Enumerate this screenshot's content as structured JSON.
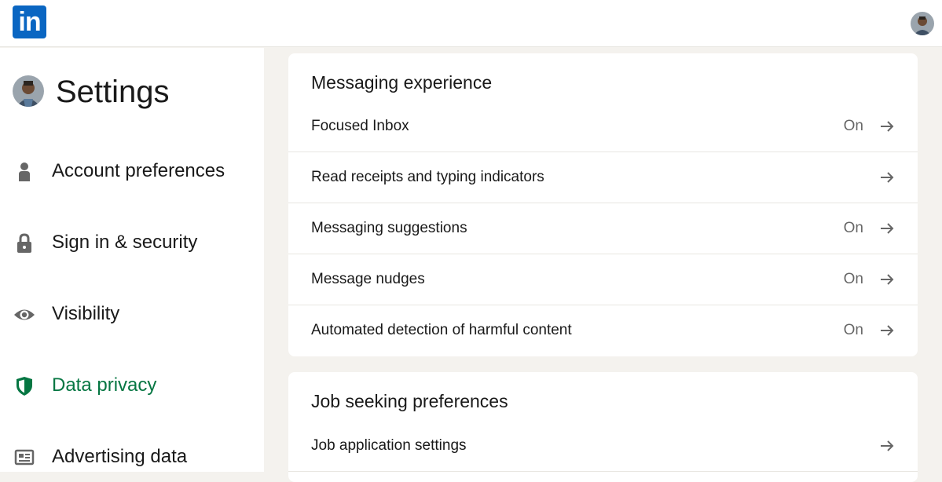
{
  "header": {
    "logo_text": "in",
    "logo_icon": "linkedin-logo",
    "avatar_icon": "user-avatar"
  },
  "colors": {
    "brand": "#0a66c2",
    "active": "#057642",
    "background": "#f4f2ee"
  },
  "sidebar": {
    "title": "Settings",
    "items": [
      {
        "label": "Account preferences",
        "icon": "person-icon"
      },
      {
        "label": "Sign in & security",
        "icon": "lock-icon"
      },
      {
        "label": "Visibility",
        "icon": "eye-icon"
      },
      {
        "label": "Data privacy",
        "icon": "shield-icon",
        "active": true
      },
      {
        "label": "Advertising data",
        "icon": "newspaper-icon"
      }
    ]
  },
  "messaging": {
    "title": "Messaging experience",
    "rows": [
      {
        "label": "Focused Inbox",
        "status": "On"
      },
      {
        "label": "Read receipts and typing indicators",
        "status": ""
      },
      {
        "label": "Messaging suggestions",
        "status": "On"
      },
      {
        "label": "Message nudges",
        "status": "On"
      },
      {
        "label": "Automated detection of harmful content",
        "status": "On"
      }
    ]
  },
  "job_seeking": {
    "title": "Job seeking preferences",
    "rows": [
      {
        "label": "Job application settings",
        "status": ""
      }
    ]
  }
}
